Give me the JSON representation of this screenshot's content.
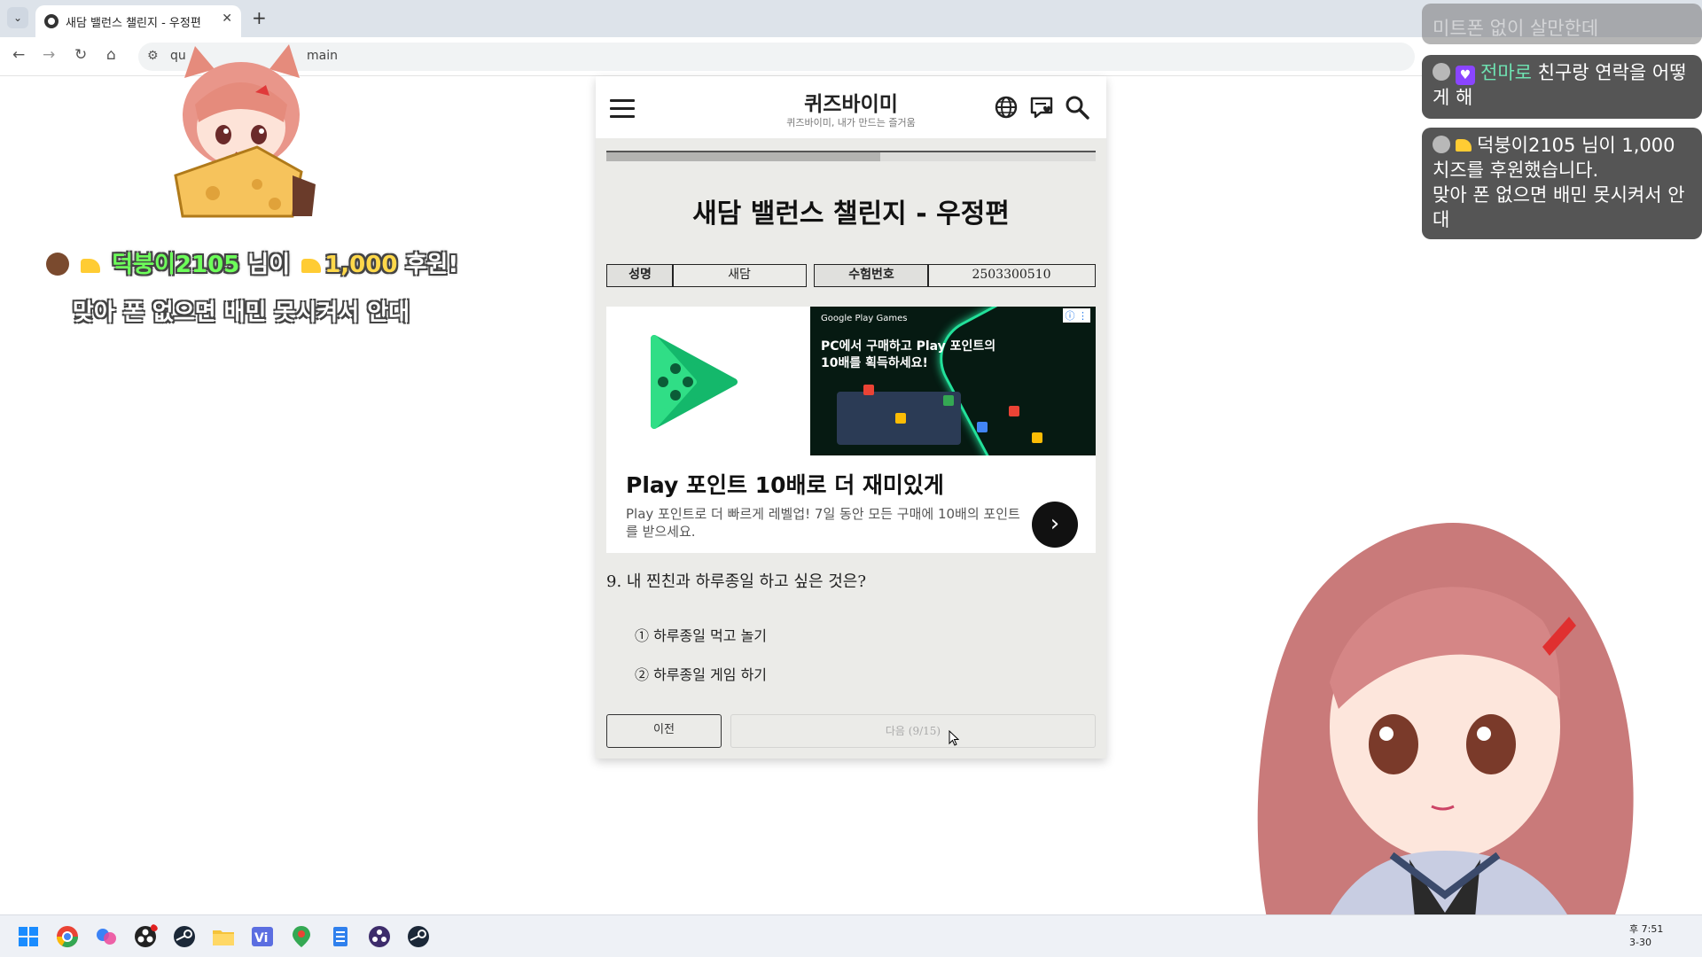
{
  "browser": {
    "tab_title": "새담 밸런스 챌린지 - 우정편",
    "tab_close": "✕",
    "new_tab": "+",
    "url_partial": "qu",
    "url_tail": "main"
  },
  "site": {
    "title": "퀴즈바이미",
    "subtitle": "퀴즈바이미, 내가 만드는 즐거움"
  },
  "quiz": {
    "title": "새담 밸런스 챌린지 - 우정편",
    "progress": 0.56,
    "info": {
      "name_label": "성명",
      "name_value": "새담",
      "id_label": "수험번호",
      "id_value": "2503300510"
    },
    "question": "9.  내 찐친과 하루종일 하고 싶은 것은?",
    "options": [
      "① 하루종일 먹고 놀기",
      "② 하루종일 게임 하기"
    ],
    "prev_label": "이전",
    "next_label": "다음 (9/15)"
  },
  "ad": {
    "banner_brand": "Google Play Games",
    "banner_text": "PC에서 구매하고 Play 포인트의 10배를 획득하세요!",
    "headline": "Play 포인트 10배로 더 재미있게",
    "body": "Play 포인트로 더 빠르게 레벨업! 7일 동안 모든 구매에 10배의 포인트를 받으세요.",
    "info_badge": "ⓘ ⋮"
  },
  "overlay": {
    "donation_nick": "덕붕이2105",
    "donation_mid": " 님이 ",
    "donation_amount": "1,000",
    "donation_suffix": " 후원!",
    "donation_message": "맞아 폰 없으면 배민 못시켜서 안대"
  },
  "chat": {
    "faded_text": "미트폰 없이 살만한데",
    "msg1_nick": "전마로",
    "msg1_text": " 친구랑 연락을 어떻게 해",
    "msg2_text": "덕붕이2105 님이 1,000 치즈를 후원했습니다.",
    "msg2_message": "맞아 폰 없으면 배민 못시켜서 안대"
  },
  "taskbar": {
    "clock_time": "후 7:51",
    "clock_date": "3-30"
  },
  "icons": {
    "menu": "hamburger-menu-icon",
    "globe": "globe-icon",
    "heart_chat": "heart-message-icon",
    "search": "search-icon",
    "back": "back-arrow-icon",
    "forward": "forward-arrow-icon",
    "reload": "reload-icon",
    "home": "home-icon"
  },
  "colors": {
    "card_bg": "#ebebe8",
    "donation_nick": "#6dff5a",
    "donation_amount": "#ffd84a",
    "chat_nick": "#6fe3b2"
  }
}
